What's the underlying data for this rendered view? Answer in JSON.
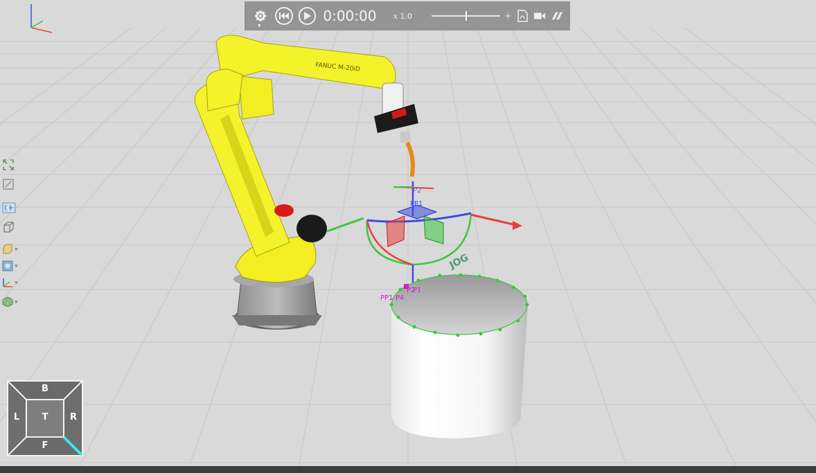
{
  "toolbar": {
    "time": "0:00:00",
    "speed": "x 1.0",
    "speed_slider": {
      "value": 0.5
    },
    "icons": [
      "gear-icon",
      "rewind-icon",
      "play-icon",
      "pdf-icon",
      "camera-icon",
      "tool-icon"
    ]
  },
  "scene": {
    "robot_label": "FANUC M-20iD",
    "jog_label": "JOG",
    "points": {
      "p2": "P2",
      "pp1_top": "PP1",
      "pp1": "PP1",
      "p4": "P4",
      "p2b": "P2",
      "p1": "P1"
    }
  },
  "left_tools": [
    "fit-view-icon",
    "zoom-box-icon",
    "section-icon",
    "box-view-icon",
    "material-icon",
    "display-mode-icon",
    "axes-icon",
    "shading-icon"
  ],
  "viewcube": {
    "top": "B",
    "left": "L",
    "center": "T",
    "right": "R",
    "bottom": "F"
  },
  "colors": {
    "robot_yellow": "#f4f22a",
    "grid": "#c8c8c8",
    "background": "#d9d9d9",
    "x_axis": "#e8403a",
    "y_axis": "#3ac93a",
    "z_axis": "#3a4de8",
    "point_marker": "#d21ad2",
    "jog_text": "#4d9a78"
  }
}
